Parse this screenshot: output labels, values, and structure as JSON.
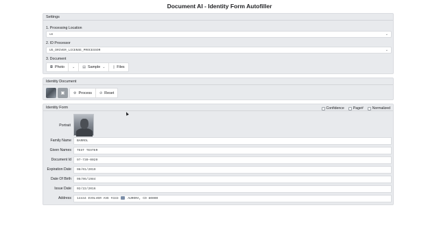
{
  "app": {
    "title": "Document AI - Identity Form Autofiller"
  },
  "settings": {
    "header": "Settings",
    "location": {
      "label": "1. Processing Location",
      "value": "us"
    },
    "processor": {
      "label": "2. ID Processor",
      "value": "US_DRIVER_LICENSE_PROCESSOR"
    },
    "document": {
      "label": "3. Document",
      "photo_label": "Photo",
      "sample_label": "Sample",
      "files_label": "Files"
    }
  },
  "identity_document": {
    "header": "Identity Document",
    "process_label": "Process",
    "reset_label": "Reset"
  },
  "identity_form": {
    "header": "Identity Form",
    "options": {
      "confidence": "Confidence",
      "page": "Page#",
      "normalized": "Normalized"
    },
    "portrait_label": "Portrait",
    "fields": [
      {
        "label": "Family Name",
        "value": "BARROL"
      },
      {
        "label": "Given Names",
        "value": "TEST TESTER"
      },
      {
        "label": "Document Id",
        "value": "97-730-0020"
      },
      {
        "label": "Expiration Date",
        "value": "08/01/2019"
      },
      {
        "label": "Date Of Birth",
        "value": "08/06/1984"
      },
      {
        "label": "Issue Date",
        "value": "02/22/2016"
      },
      {
        "label": "Address",
        "value_before": "14444 EVOLVER AVE #333",
        "value_after": "AURORA, CO 80000"
      }
    ]
  },
  "icons": {
    "photo": "camera-icon",
    "dropdown": "chevron-down-icon",
    "sample": "document-icon",
    "files": "file-icon",
    "process": "gear-icon",
    "reset": "reset-icon"
  }
}
